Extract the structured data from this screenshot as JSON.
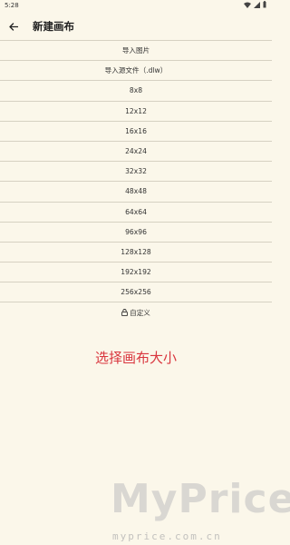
{
  "status_bar": {
    "time": "5:28",
    "icons": [
      "wifi-icon",
      "signal-icon",
      "battery-icon"
    ]
  },
  "app_bar": {
    "title": "新建画布",
    "back_icon": "arrow-left-icon"
  },
  "menu": {
    "items": [
      {
        "label": "导入图片"
      },
      {
        "label": "导入源文件（.dlw）"
      },
      {
        "label": "8x8"
      },
      {
        "label": "12x12"
      },
      {
        "label": "16x16"
      },
      {
        "label": "24x24"
      },
      {
        "label": "32x32"
      },
      {
        "label": "48x48"
      },
      {
        "label": "64x64"
      },
      {
        "label": "96x96"
      },
      {
        "label": "128x128"
      },
      {
        "label": "192x192"
      },
      {
        "label": "256x256"
      },
      {
        "label": "自定义",
        "icon": "lock-icon"
      }
    ]
  },
  "caption": "选择画布大小",
  "watermark": {
    "big": "MyPrice",
    "small": "myprice.com.cn"
  }
}
